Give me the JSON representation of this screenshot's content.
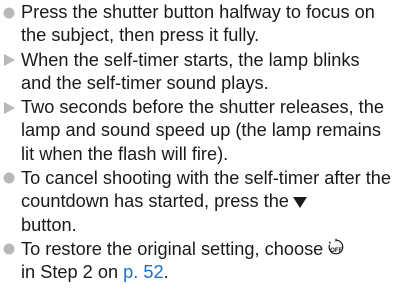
{
  "colors": {
    "text": "#1a1a1a",
    "bullet_dot": "#b8b8b8",
    "bullet_arrow": "#b8b8b8",
    "link": "#1f6fc0"
  },
  "items": [
    {
      "marker": "bullet-dot-icon",
      "text": "Press the shutter button halfway to focus on the subject, then press it fully."
    },
    {
      "marker": "bullet-arrow-icon",
      "text": "When the self-timer starts, the lamp blinks and the self-timer sound plays."
    },
    {
      "marker": "bullet-arrow-icon",
      "text": "Two seconds before the shutter releases, the lamp and sound speed up (the lamp remains lit when the flash will fire)."
    },
    {
      "marker": "bullet-dot-icon",
      "text_before": "To cancel shooting with the self-timer after the countdown has started, press the",
      "icon": "down-triangle-icon",
      "text_after": "button."
    },
    {
      "marker": "bullet-dot-icon",
      "text_before": "To restore the original setting, choose",
      "icon": "self-timer-off-icon",
      "text_middle": "in Step 2 on",
      "link_text": "p. 52",
      "text_end": "."
    }
  ]
}
